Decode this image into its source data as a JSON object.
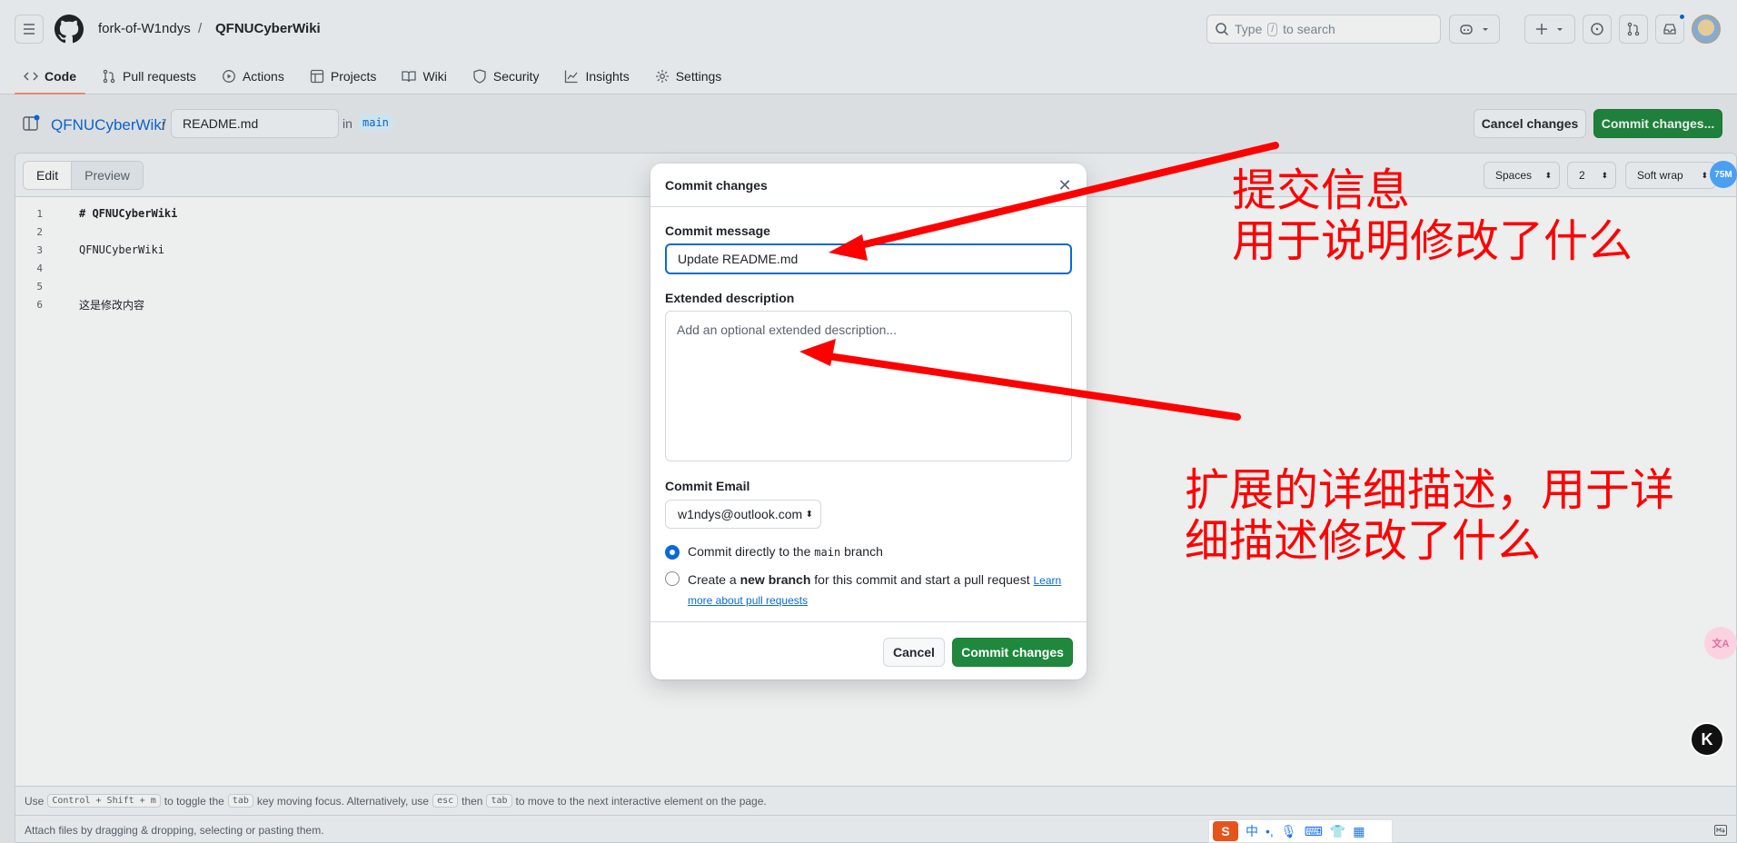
{
  "header": {
    "owner": "fork-of-W1ndys",
    "separator": "/",
    "repo": "QFNUCyberWiki",
    "search_text": "Type",
    "search_key": "/",
    "search_suffix": "to search"
  },
  "nav": {
    "items": [
      {
        "label": "Code",
        "icon": "code-icon"
      },
      {
        "label": "Pull requests",
        "icon": "git-pull-request-icon"
      },
      {
        "label": "Actions",
        "icon": "play-icon"
      },
      {
        "label": "Projects",
        "icon": "table-icon"
      },
      {
        "label": "Wiki",
        "icon": "book-icon"
      },
      {
        "label": "Security",
        "icon": "shield-icon"
      },
      {
        "label": "Insights",
        "icon": "graph-icon"
      },
      {
        "label": "Settings",
        "icon": "gear-icon"
      }
    ]
  },
  "editbar": {
    "repo_link": "QFNUCyberWiki",
    "slash": "/",
    "filename": "README.md",
    "in": "in",
    "branch": "main",
    "cancel": "Cancel changes",
    "commit": "Commit changes..."
  },
  "editor": {
    "tab_edit": "Edit",
    "tab_preview": "Preview",
    "indent_mode": "Spaces",
    "indent_size": "2",
    "wrap_mode": "Soft wrap",
    "lines": [
      {
        "n": "1",
        "text": "# QFNUCyberWiki"
      },
      {
        "n": "2",
        "text": ""
      },
      {
        "n": "3",
        "text": "QFNUCyberWiki"
      },
      {
        "n": "4",
        "text": ""
      },
      {
        "n": "5",
        "text": ""
      },
      {
        "n": "6",
        "text": "这是修改内容"
      }
    ],
    "hint": {
      "use": "Use",
      "k1": "Control + Shift + m",
      "t1": "to toggle the",
      "k2": "tab",
      "t2": "key moving focus. Alternatively, use",
      "k3": "esc",
      "t3": "then",
      "k4": "tab",
      "t4": "to move to the next interactive element on the page."
    },
    "attach": "Attach files by dragging & dropping, selecting or pasting them."
  },
  "modal": {
    "title": "Commit changes",
    "message_label": "Commit message",
    "message_value": "Update README.md",
    "desc_label": "Extended description",
    "desc_placeholder": "Add an optional extended description...",
    "email_label": "Commit Email",
    "email_value": "w1ndys@outlook.com",
    "radio1_pre": "Commit directly to the",
    "radio1_branch": "main",
    "radio1_post": "branch",
    "radio2_pre": "Create a",
    "radio2_bold": "new branch",
    "radio2_post": "for this commit and start a pull request",
    "radio2_link": "Learn more about pull requests",
    "cancel": "Cancel",
    "commit": "Commit changes"
  },
  "annotations": {
    "a1_line1": "提交信息",
    "a1_line2": "用于说明修改了什么",
    "a2_line1": "扩展的详细描述，用于详",
    "a2_line2": "细描述修改了什么"
  },
  "floaters": {
    "badge": "75M",
    "translate": "文A",
    "kbd": "K"
  },
  "ime": {
    "s": "S",
    "zh": "中"
  },
  "colors": {
    "accent": "#0969da",
    "primary_button": "#1f883d",
    "annotation": "#ff0000",
    "nav_underline": "#fd8c73"
  }
}
